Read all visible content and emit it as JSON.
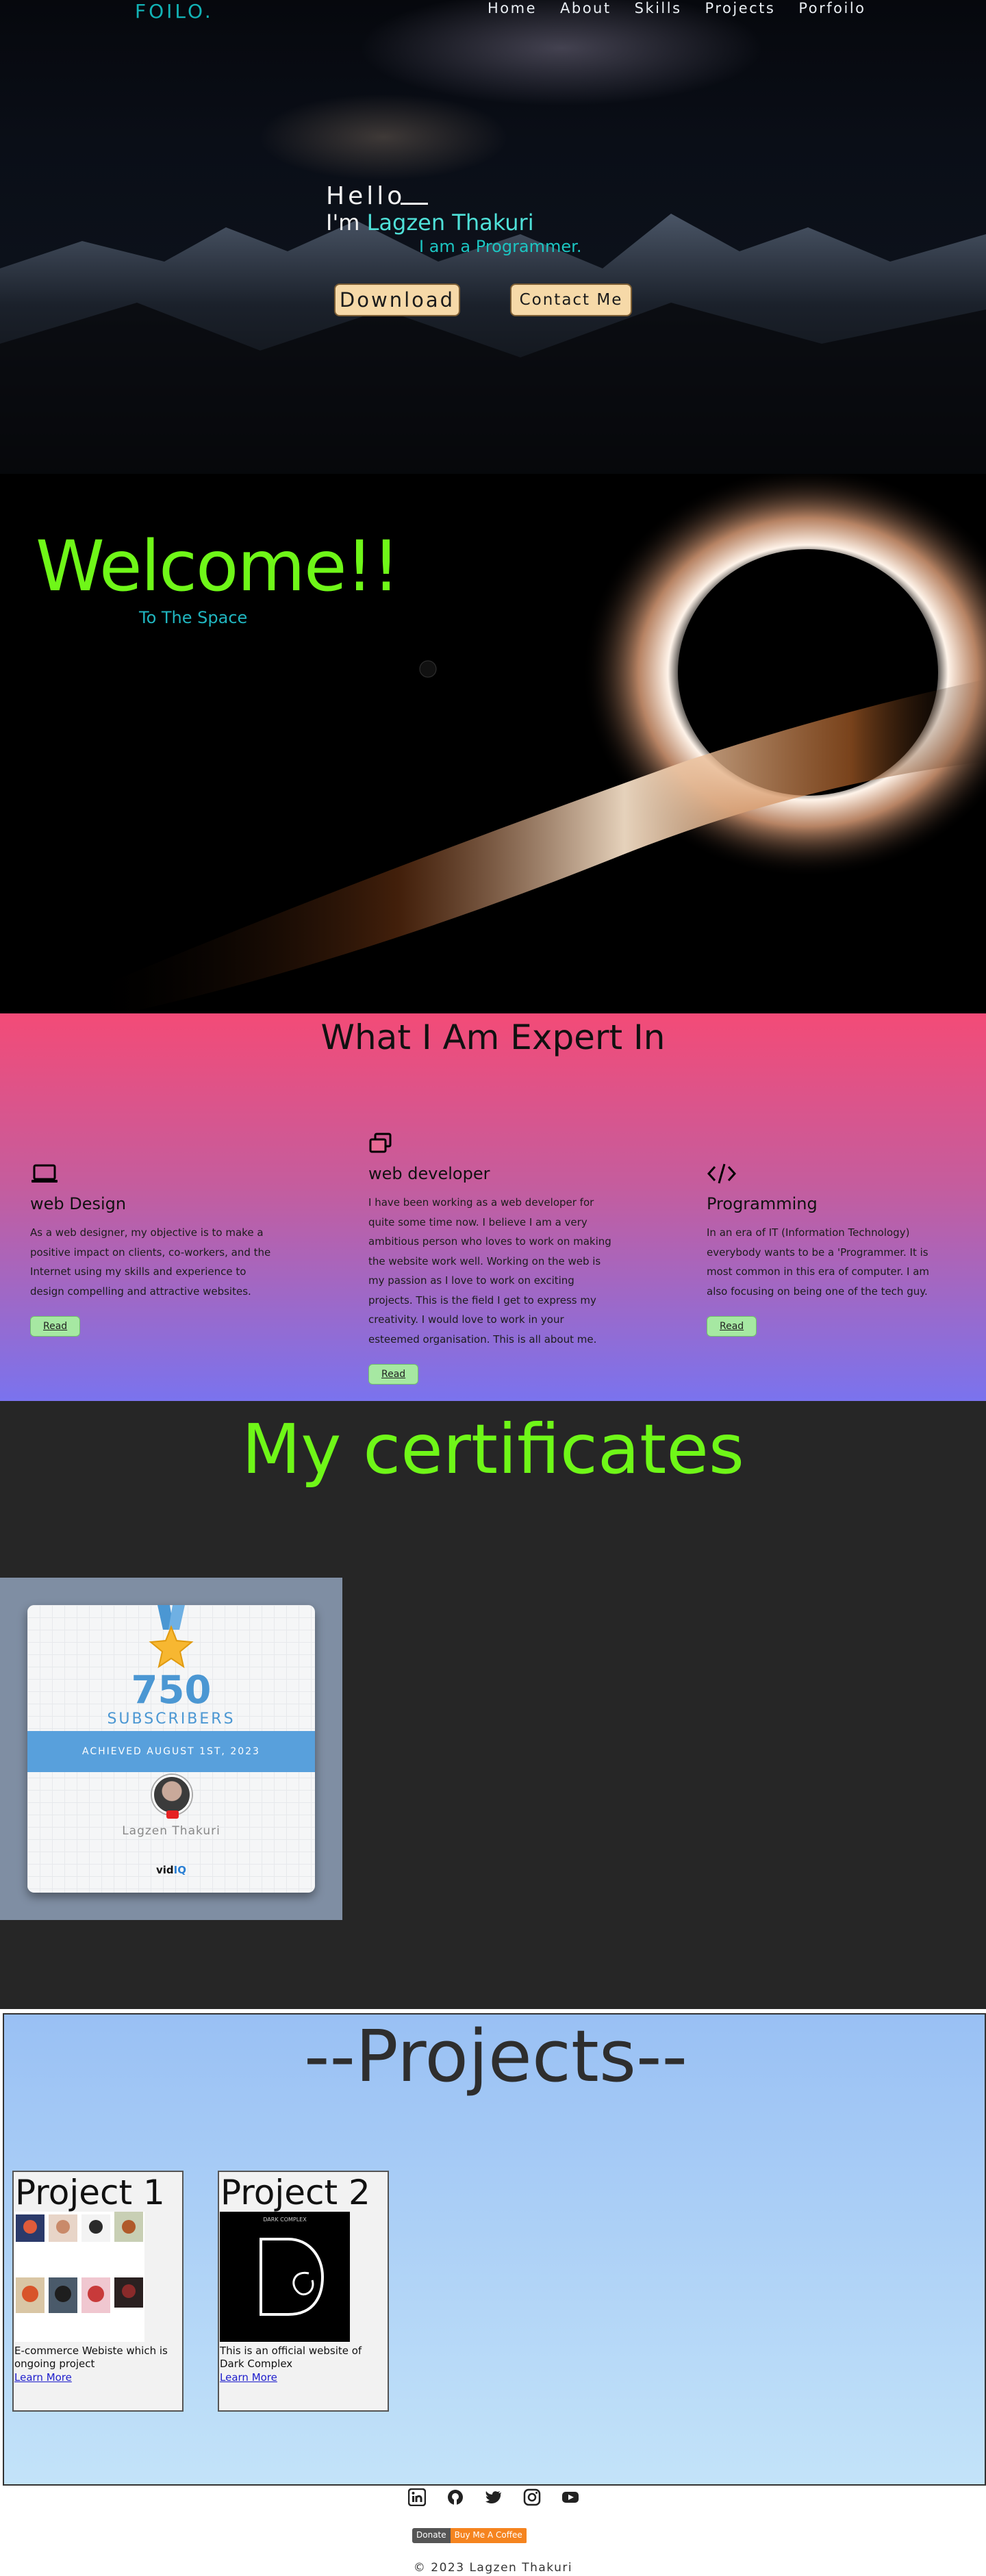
{
  "nav": {
    "logo": "FOILO.",
    "links": [
      "Home",
      "About",
      "Skills",
      "Projects",
      "Porfoilo"
    ]
  },
  "hero": {
    "hello": "Hello",
    "im": "I'm ",
    "name": "Lagzen Thakuri",
    "role": "I am a Programmer.",
    "download_label": "Download",
    "contact_label": "Contact Me"
  },
  "welcome": {
    "title": "Welcome!!",
    "subtitle": "To The Space"
  },
  "expert": {
    "title": "What I Am Expert In",
    "cards": [
      {
        "icon": "laptop-icon",
        "heading": "web Design",
        "text": "As a web designer, my objective is to make a positive impact on clients, co-workers, and the Internet using my skills and experience to design compelling and attractive websites.",
        "button": "Read"
      },
      {
        "icon": "windows-icon",
        "heading": "web developer",
        "text": "I have been working as a web developer for quite some time now. I believe I am a very ambitious person who loves to work on making the website work well. Working on the web is my passion as I love to work on exciting projects. This is the field I get to express my creativity. I would love to work in your esteemed organisation. This is all about me.",
        "button": "Read"
      },
      {
        "icon": "code-icon",
        "heading": "Programming",
        "text": "In an era of IT (Information Technology) everybody wants to be a 'Programmer. It is most common in this era of computer. I am also focusing on being one of the tech guy.",
        "button": "Read"
      }
    ]
  },
  "certs": {
    "title": "My certificates",
    "card": {
      "count": "750",
      "label": "SUBSCRIBERS",
      "achieved": "ACHIEVED AUGUST 1ST, 2023",
      "name": "Lagzen Thakuri",
      "brand_a": "vid",
      "brand_b": "IQ"
    }
  },
  "projects": {
    "title": "--Projects--",
    "items": [
      {
        "title": "Project 1",
        "desc": "E-commerce Webiste which is ongoing project",
        "link": "Learn More"
      },
      {
        "title": "Project 2",
        "desc": "This is an official website of Dark Complex",
        "link": "Learn More",
        "image_caption": "DARK COMPLEX"
      }
    ]
  },
  "footer": {
    "icons": [
      "linkedin-icon",
      "github-icon",
      "twitter-icon",
      "instagram-icon",
      "youtube-icon"
    ],
    "donate_left": "Donate",
    "donate_right": "Buy Me A Coffee",
    "copyright": "© 2023 Lagzen Thakuri"
  },
  "colors": {
    "accent_cyan": "#12b3b6",
    "accent_green": "#6ff718",
    "button_beige": "#f6d9a8"
  }
}
